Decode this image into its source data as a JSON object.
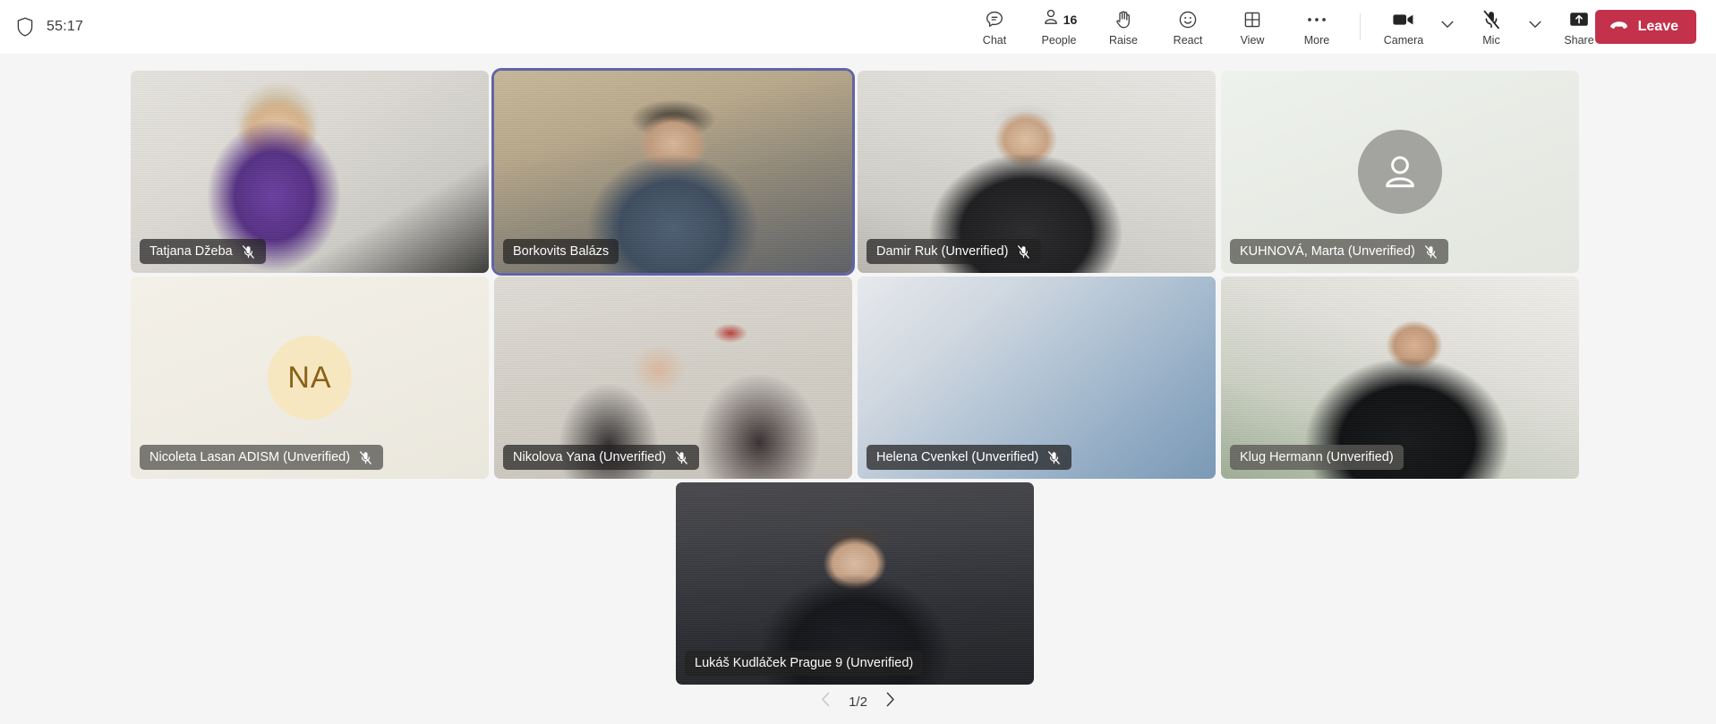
{
  "topbar": {
    "shield_icon": "shield-icon",
    "timer": "55:17",
    "actions": [
      {
        "id": "chat",
        "label": "Chat",
        "icon": "chat-icon"
      },
      {
        "id": "people",
        "label": "People",
        "icon": "people-icon",
        "count": "16"
      },
      {
        "id": "raise",
        "label": "Raise",
        "icon": "raise-hand-icon"
      },
      {
        "id": "react",
        "label": "React",
        "icon": "react-smiley-icon"
      },
      {
        "id": "view",
        "label": "View",
        "icon": "view-grid-icon"
      },
      {
        "id": "more",
        "label": "More",
        "icon": "more-ellipsis-icon"
      }
    ],
    "devices": [
      {
        "id": "camera",
        "label": "Camera",
        "icon": "camera-icon",
        "muted": false
      },
      {
        "id": "mic",
        "label": "Mic",
        "icon": "mic-muted-icon",
        "muted": true
      },
      {
        "id": "share",
        "label": "Share",
        "icon": "share-screen-icon"
      }
    ],
    "leave": {
      "label": "Leave",
      "icon": "hangup-phone-icon",
      "color": "#c4314b"
    }
  },
  "stage": {
    "active_speaker_color": "#6264a7",
    "participants": [
      {
        "name": "Tatjana Džeba",
        "muted": true,
        "active": false,
        "video": true,
        "label_style": "dark"
      },
      {
        "name": "Borkovits Balázs",
        "muted": false,
        "active": true,
        "video": true,
        "label_style": "dark"
      },
      {
        "name": "Damir Ruk (Unverified)",
        "muted": true,
        "active": false,
        "video": true,
        "label_style": "dark"
      },
      {
        "name": "KUHNOVÁ, Marta (Unverified)",
        "muted": true,
        "active": false,
        "video": false,
        "label_style": "light",
        "avatar": {
          "type": "person-silhouette",
          "bg": "#a3a3a0",
          "fg": "#ffffff"
        }
      },
      {
        "name": "Nicoleta Lasan ADISM (Unverified)",
        "muted": true,
        "active": false,
        "video": false,
        "label_style": "light",
        "avatar": {
          "type": "initials",
          "initials": "NA",
          "bg": "#f6e7c1",
          "fg": "#8a6116"
        }
      },
      {
        "name": "Nikolova Yana (Unverified)",
        "muted": true,
        "active": false,
        "video": true,
        "label_style": "dark"
      },
      {
        "name": "Helena Cvenkel (Unverified)",
        "muted": true,
        "active": false,
        "video": true,
        "label_style": "dark"
      },
      {
        "name": "Klug Hermann (Unverified)",
        "muted": false,
        "active": false,
        "video": true,
        "label_style": "light"
      },
      {
        "name": "Lukáš Kudláček Prague 9 (Unverified)",
        "muted": false,
        "active": false,
        "video": true,
        "label_style": "dark"
      }
    ]
  },
  "pagination": {
    "prev_icon": "chevron-left-icon",
    "next_icon": "chevron-right-icon",
    "page_text": "1/2",
    "prev_enabled": false,
    "next_enabled": true
  }
}
